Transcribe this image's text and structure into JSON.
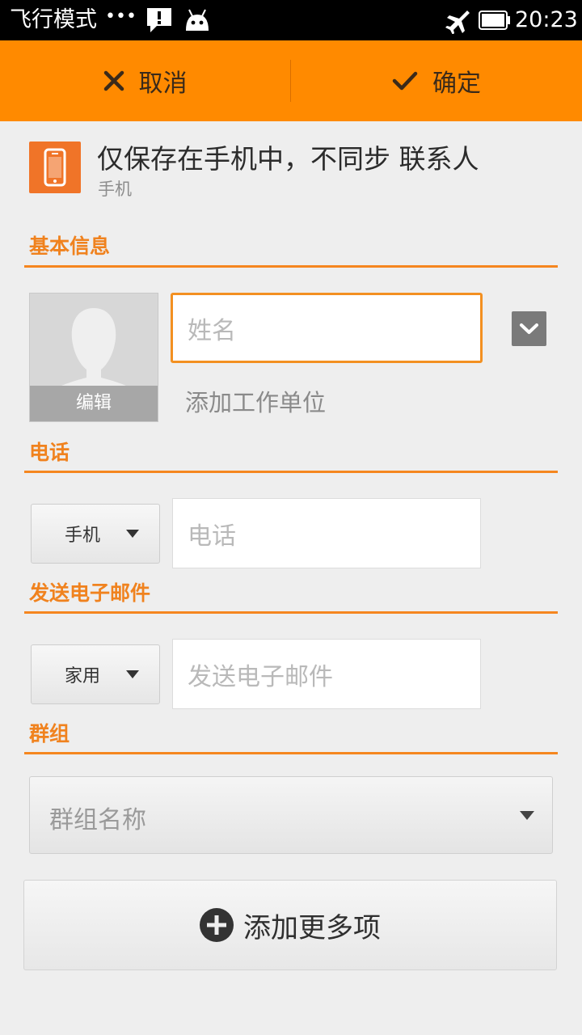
{
  "status_bar": {
    "left_text": "飞行模式",
    "dots": "•••",
    "time": "20:23",
    "icons": [
      "notification-alert-icon",
      "android-icon",
      "airplane-mode-icon",
      "battery-icon"
    ]
  },
  "action_bar": {
    "cancel_label": "取消",
    "confirm_label": "确定"
  },
  "account": {
    "title": "仅保存在手机中，不同步 联系人",
    "subtitle": "手机"
  },
  "sections": {
    "basic": {
      "title": "基本信息"
    },
    "phone": {
      "title": "电话"
    },
    "email": {
      "title": "发送电子邮件"
    },
    "group": {
      "title": "群组"
    }
  },
  "basic": {
    "photo_edit_label": "编辑",
    "name_placeholder": "姓名",
    "add_company_label": "添加工作单位"
  },
  "phone": {
    "type_label": "手机",
    "placeholder": "电话"
  },
  "email": {
    "type_label": "家用",
    "placeholder": "发送电子邮件"
  },
  "group": {
    "placeholder": "群组名称"
  },
  "add_more_label": "添加更多项",
  "colors": {
    "accent": "#ff8a00",
    "section_text": "#f0821e",
    "account_icon": "#f07428"
  }
}
